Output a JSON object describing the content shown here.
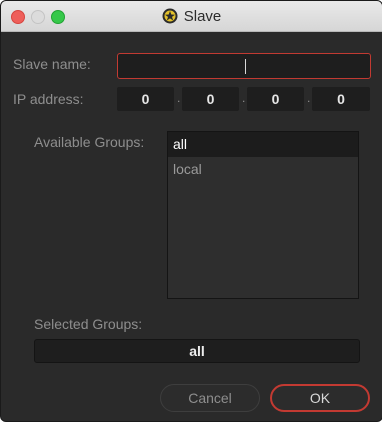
{
  "window": {
    "title": "Slave",
    "icon": "fusion-logo-icon"
  },
  "form": {
    "slave_name_label": "Slave name:",
    "slave_name_value": "",
    "ip_label": "IP address:",
    "ip": [
      "0",
      "0",
      "0",
      "0"
    ],
    "ip_separator": "."
  },
  "groups": {
    "available_label": "Available Groups:",
    "available": [
      {
        "label": "all",
        "selected": true
      },
      {
        "label": "local",
        "selected": false
      }
    ],
    "selected_label": "Selected Groups:",
    "selected_value": "all"
  },
  "buttons": {
    "cancel": "Cancel",
    "ok": "OK"
  },
  "colors": {
    "dialog_bg": "#2a2a2a",
    "field_bg": "#1e1e1e",
    "accent_red": "#c33a32",
    "traffic_close": "#ee5f5a",
    "traffic_max": "#36c84a"
  }
}
